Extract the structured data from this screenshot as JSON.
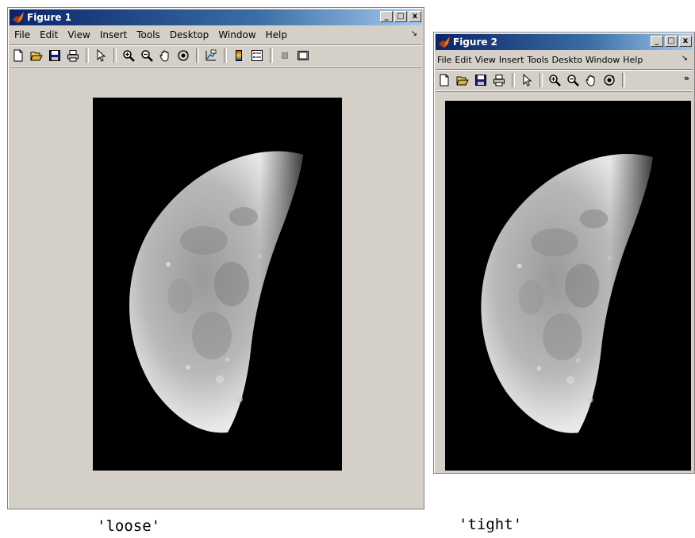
{
  "figure1": {
    "title": "Figure 1",
    "window_buttons": {
      "minimize": "_",
      "maximize": "□",
      "close": "x"
    },
    "menu": [
      "File",
      "Edit",
      "View",
      "Insert",
      "Tools",
      "Desktop",
      "Window",
      "Help"
    ],
    "menu_arrow": "↘",
    "toolbar_icons": [
      "new-file-icon",
      "open-folder-icon",
      "save-icon",
      "print-icon",
      "pointer-icon",
      "zoom-in-icon",
      "zoom-out-icon",
      "pan-hand-icon",
      "rotate-3d-icon",
      "data-cursor-icon",
      "colorbar-icon",
      "legend-icon",
      "hide-plot-tools-icon",
      "show-plot-tools-icon"
    ],
    "caption": "'loose'"
  },
  "figure2": {
    "title": "Figure 2",
    "window_buttons": {
      "minimize": "_",
      "maximize": "□",
      "close": "x"
    },
    "menu": [
      "File",
      "Edit",
      "View",
      "Insert",
      "Tools",
      "Deskto",
      "Window",
      "Help"
    ],
    "menu_arrow": "↘",
    "toolbar_more": "»",
    "toolbar_icons": [
      "new-file-icon",
      "open-folder-icon",
      "save-icon",
      "print-icon",
      "pointer-icon",
      "zoom-in-icon",
      "zoom-out-icon",
      "pan-hand-icon",
      "rotate-3d-icon"
    ],
    "caption": "'tight'"
  },
  "colors": {
    "titlebar_start": "#0a246a",
    "titlebar_end": "#a6caf0",
    "window_bg": "#d4d0c8",
    "image_bg": "#000000"
  }
}
